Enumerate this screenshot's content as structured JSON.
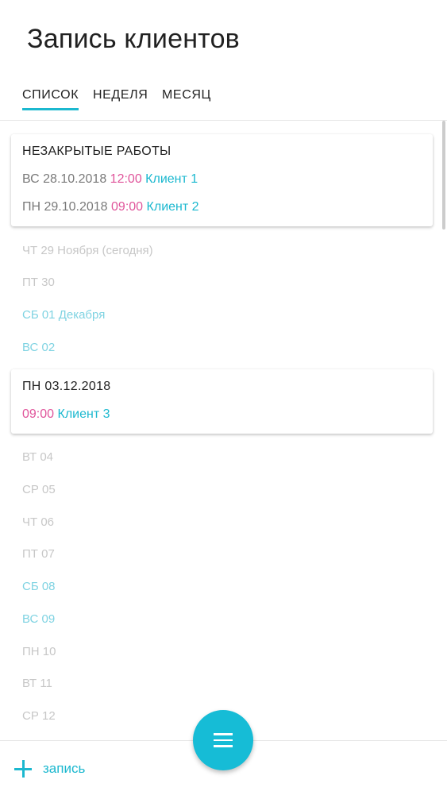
{
  "header": {
    "title": "Запись клиентов"
  },
  "tabs": [
    {
      "label": "СПИСОК",
      "active": true
    },
    {
      "label": "НЕДЕЛЯ",
      "active": false
    },
    {
      "label": "МЕСЯЦ",
      "active": false
    }
  ],
  "open_works": {
    "title": "НЕЗАКРЫТЫЕ РАБОТЫ",
    "entries": [
      {
        "date": "ВС 28.10.2018",
        "time": "12:00",
        "client": "Клиент 1"
      },
      {
        "date": "ПН 29.10.2018",
        "time": "09:00",
        "client": "Клиент 2"
      }
    ]
  },
  "days_before": [
    {
      "label": "ЧТ 29 Ноября (сегодня)",
      "weekend": false
    },
    {
      "label": "ПТ 30",
      "weekend": false
    },
    {
      "label": "СБ 01 Декабря",
      "weekend": true
    },
    {
      "label": "ВС 02",
      "weekend": true
    }
  ],
  "day_card": {
    "title": "ПН 03.12.2018",
    "entries": [
      {
        "time": "09:00",
        "client": "Клиент 3"
      }
    ]
  },
  "days_after": [
    {
      "label": "ВТ 04",
      "weekend": false
    },
    {
      "label": "СР 05",
      "weekend": false
    },
    {
      "label": "ЧТ 06",
      "weekend": false
    },
    {
      "label": "ПТ 07",
      "weekend": false
    },
    {
      "label": "СБ 08",
      "weekend": true
    },
    {
      "label": "ВС 09",
      "weekend": true
    },
    {
      "label": "ПН 10",
      "weekend": false
    },
    {
      "label": "ВТ 11",
      "weekend": false
    },
    {
      "label": "СР 12",
      "weekend": false
    }
  ],
  "bottom_bar": {
    "add_label": "запись",
    "add_icon": "plus-icon",
    "fab_icon": "menu-icon"
  },
  "colors": {
    "accent": "#1bb8cf",
    "time": "#e0559b",
    "weekend": "#7fd3e2",
    "weekday": "#c7c7c7"
  }
}
